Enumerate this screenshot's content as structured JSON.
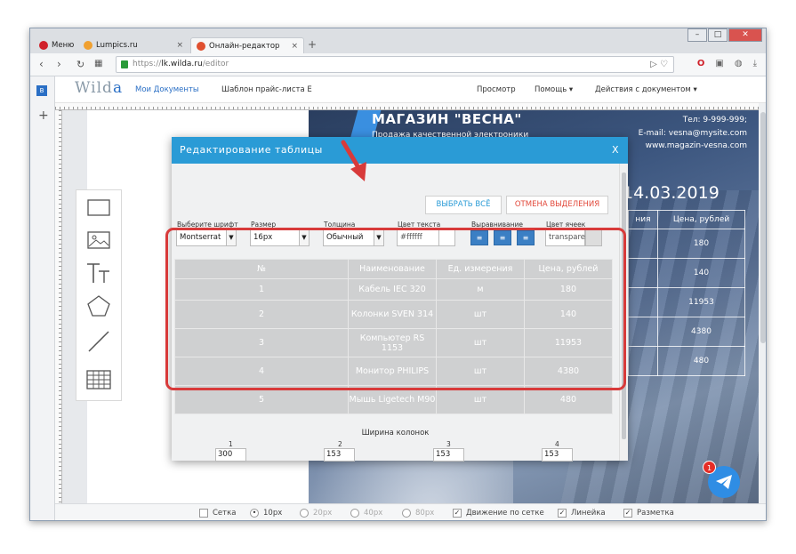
{
  "browser": {
    "tabs": [
      {
        "label": "Меню"
      },
      {
        "label": "Lumpics.ru"
      },
      {
        "label": "Онлайн-редактор"
      }
    ],
    "new_tab": "+",
    "close_glyph": "×",
    "url_prefix": "https://",
    "url_host": "lk.wilda.ru",
    "url_path": "/editor"
  },
  "app": {
    "logo_prefix": "Wild",
    "logo_suffix": "a",
    "my_docs": "Мои Документы",
    "template_name": "Шаблон прайс-листа Е",
    "preview": "Просмотр",
    "help": "Помощь ▾",
    "doc_actions": "Действия с документом ▾"
  },
  "page": {
    "shop_name": "МАГАЗИН \"ВЕСНА\"",
    "shop_sub": "Продажа качественной электроники",
    "phone": "Тел: 9-999-999;",
    "email": "E-mail: vesna@mysite.com",
    "site": "www.magazin-vesna.com",
    "date": "14.03.2019",
    "bg_header_left": "ния",
    "bg_header_right": "Цена, рублей",
    "bg_prices": [
      "180",
      "140",
      "11953",
      "4380",
      "480"
    ]
  },
  "modal": {
    "title": "Редактирование таблицы",
    "close": "X",
    "select_all": "ВЫБРАТЬ ВСЁ",
    "deselect": "ОТМЕНА ВЫДЕЛЕНИЯ",
    "font_label": "Выберите шрифт",
    "font_value": "Montserrat",
    "size_label": "Размер",
    "size_value": "16px",
    "weight_label": "Толщина",
    "weight_value": "Обычный",
    "text_color_label": "Цвет текста",
    "text_color_value": "#ffffff",
    "align_label": "Выравнивание",
    "cell_color_label": "Цвет ячеек",
    "cell_color_value": "transpare",
    "table": {
      "headers": [
        "№",
        "Наименование",
        "Ед. измерения",
        "Цена, рублей"
      ],
      "rows": [
        [
          "1",
          "Кабель IEC 320",
          "м",
          "180"
        ],
        [
          "2",
          "Колонки SVEN 314",
          "шт",
          "140"
        ],
        [
          "3",
          "Компьютер RS 1153",
          "шт",
          "11953"
        ],
        [
          "4",
          "Монитор PHILIPS",
          "шт",
          "4380"
        ],
        [
          "5",
          "Мышь Ligetech M90",
          "шт",
          "480"
        ]
      ]
    },
    "widths_title": "Ширина колонок",
    "widths": [
      {
        "n": "1",
        "v": "300"
      },
      {
        "n": "2",
        "v": "153"
      },
      {
        "n": "3",
        "v": "153"
      },
      {
        "n": "4",
        "v": "153"
      }
    ]
  },
  "bottom": {
    "grid": "Сетка",
    "s10": "10px",
    "s20": "20px",
    "s40": "40px",
    "s80": "80px",
    "snap": "Движение по сетке",
    "ruler": "Линейка",
    "markup": "Разметка"
  },
  "badge": "1",
  "colors": {
    "accent": "#2a9bd6",
    "red": "#d83a3a",
    "cancel": "#e2483a"
  }
}
